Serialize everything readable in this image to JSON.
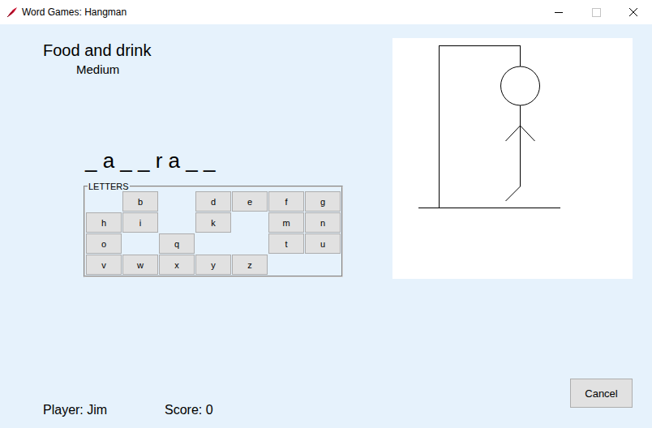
{
  "window": {
    "title": "Word Games: Hangman"
  },
  "category": "Food and drink",
  "difficulty": "Medium",
  "word": "_ a _ _ r a _ _",
  "letters": {
    "legend": "LETTERS",
    "keys": [
      "",
      "b",
      "",
      "d",
      "e",
      "f",
      "g",
      "h",
      "i",
      "",
      "k",
      "",
      "m",
      "n",
      "o",
      "",
      "q",
      "",
      "",
      "t",
      "u",
      "v",
      "w",
      "x",
      "y",
      "z",
      "",
      ""
    ]
  },
  "hangman": {
    "parts": [
      {
        "part": "head",
        "shown": true
      },
      {
        "part": "body",
        "shown": true
      },
      {
        "part": "left-arm",
        "shown": true
      },
      {
        "part": "right-arm",
        "shown": true
      },
      {
        "part": "left-leg",
        "shown": true
      },
      {
        "part": "right-leg",
        "shown": false
      }
    ]
  },
  "player": "Player: Jim",
  "score": "Score: 0",
  "buttons": [
    "Cancel"
  ]
}
